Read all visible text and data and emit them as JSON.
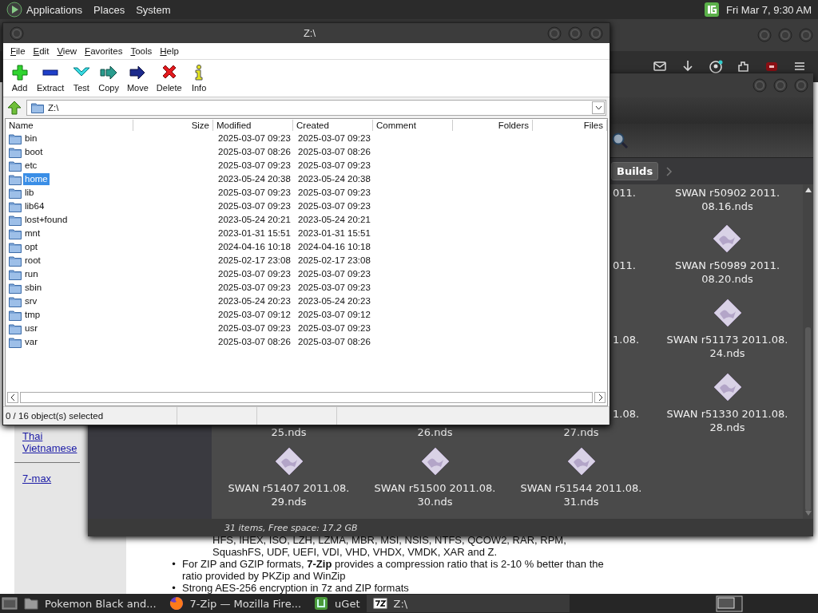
{
  "top_panel": {
    "menus": [
      "Applications",
      "Places",
      "System"
    ],
    "clock": "Fri Mar  7, 9:30 AM"
  },
  "browser": {
    "sidebar_links": [
      "Thai",
      "Vietnamese",
      "7-max"
    ],
    "format_lines": [
      "HFS, IHEX, ISO, LZH, LZMA, MBR, MSI, NSIS, NTFS, QCOW2, RAR, RPM,",
      "SquashFS, UDF, UEFI, VDI, VHD, VHDX, VMDK, XAR and Z."
    ],
    "bullets": [
      {
        "marker": "•",
        "text": "For ZIP and GZIP formats, **7-Zip** provides a compression ratio that is 2-10 % better than the ratio provided by PKZip and WinZip"
      },
      {
        "marker": "•",
        "text": "Strong AES-256 encryption in 7z and ZIP formats"
      }
    ]
  },
  "file_manager": {
    "breadcrumb": [
      {
        "label": "Builds",
        "selected": true
      }
    ],
    "grid": [
      [
        {
          "kind": "covered"
        },
        {
          "kind": "covered"
        },
        {
          "kind": "fragment",
          "edge": "011."
        },
        {
          "kind": "label-only",
          "lines": [
            "SWAN r50902 2011.",
            "08.16.nds"
          ]
        }
      ],
      [
        {
          "kind": "covered"
        },
        {
          "kind": "covered"
        },
        {
          "kind": "fragment",
          "edge": "011."
        },
        {
          "kind": "file",
          "lines": [
            "SWAN r50989 2011.",
            "08.20.nds"
          ]
        }
      ],
      [
        {
          "kind": "covered"
        },
        {
          "kind": "covered"
        },
        {
          "kind": "fragment",
          "edge": "1.08."
        },
        {
          "kind": "file",
          "lines": [
            "SWAN r51173 2011.08.",
            "24.nds"
          ]
        }
      ],
      [
        {
          "kind": "fragment",
          "tail": "25.nds"
        },
        {
          "kind": "fragment",
          "tail": "26.nds"
        },
        {
          "kind": "fragment",
          "edge": "1.08.",
          "tail": "27.nds"
        },
        {
          "kind": "file",
          "lines": [
            "SWAN r51330 2011.08.",
            "28.nds"
          ]
        }
      ],
      [
        {
          "kind": "file",
          "lines": [
            "SWAN r51407 2011.08.",
            "29.nds"
          ]
        },
        {
          "kind": "file",
          "lines": [
            "SWAN r51500 2011.08.",
            "30.nds"
          ]
        },
        {
          "kind": "file",
          "lines": [
            "SWAN r51544 2011.08.",
            "31.nds"
          ]
        }
      ]
    ],
    "status": "31 items, Free space: 17.2 GB"
  },
  "seven_zip": {
    "title": "Z:\\",
    "menu": [
      "File",
      "Edit",
      "View",
      "Favorites",
      "Tools",
      "Help"
    ],
    "toolbar": [
      {
        "kind": "add",
        "label": "Add"
      },
      {
        "kind": "extract",
        "label": "Extract"
      },
      {
        "kind": "test",
        "label": "Test"
      },
      {
        "kind": "copy",
        "label": "Copy"
      },
      {
        "kind": "move",
        "label": "Move"
      },
      {
        "kind": "delete",
        "label": "Delete"
      },
      {
        "kind": "info",
        "label": "Info"
      }
    ],
    "address": "Z:\\",
    "columns": [
      "Name",
      "Size",
      "Modified",
      "Created",
      "Comment",
      "Folders",
      "Files"
    ],
    "rows": [
      {
        "name": "bin",
        "modified": "2025-03-07 09:23",
        "created": "2025-03-07 09:23",
        "selected": false
      },
      {
        "name": "boot",
        "modified": "2025-03-07 08:26",
        "created": "2025-03-07 08:26",
        "selected": false
      },
      {
        "name": "etc",
        "modified": "2025-03-07 09:23",
        "created": "2025-03-07 09:23",
        "selected": false
      },
      {
        "name": "home",
        "modified": "2023-05-24 20:38",
        "created": "2023-05-24 20:38",
        "selected": true
      },
      {
        "name": "lib",
        "modified": "2025-03-07 09:23",
        "created": "2025-03-07 09:23",
        "selected": false
      },
      {
        "name": "lib64",
        "modified": "2025-03-07 09:23",
        "created": "2025-03-07 09:23",
        "selected": false
      },
      {
        "name": "lost+found",
        "modified": "2023-05-24 20:21",
        "created": "2023-05-24 20:21",
        "selected": false
      },
      {
        "name": "mnt",
        "modified": "2023-01-31 15:51",
        "created": "2023-01-31 15:51",
        "selected": false
      },
      {
        "name": "opt",
        "modified": "2024-04-16 10:18",
        "created": "2024-04-16 10:18",
        "selected": false
      },
      {
        "name": "root",
        "modified": "2025-02-17 23:08",
        "created": "2025-02-17 23:08",
        "selected": false
      },
      {
        "name": "run",
        "modified": "2025-03-07 09:23",
        "created": "2025-03-07 09:23",
        "selected": false
      },
      {
        "name": "sbin",
        "modified": "2025-03-07 09:23",
        "created": "2025-03-07 09:23",
        "selected": false
      },
      {
        "name": "srv",
        "modified": "2023-05-24 20:23",
        "created": "2023-05-24 20:23",
        "selected": false
      },
      {
        "name": "tmp",
        "modified": "2025-03-07 09:12",
        "created": "2025-03-07 09:12",
        "selected": false
      },
      {
        "name": "usr",
        "modified": "2025-03-07 09:23",
        "created": "2025-03-07 09:23",
        "selected": false
      },
      {
        "name": "var",
        "modified": "2025-03-07 08:26",
        "created": "2025-03-07 08:26",
        "selected": false
      }
    ],
    "status": "0 / 16 object(s) selected"
  },
  "taskbar": {
    "items": [
      {
        "kind": "folder",
        "label": "Pokemon Black and...",
        "selected": false
      },
      {
        "kind": "firefox",
        "label": "7-Zip — Mozilla Fire...",
        "selected": false
      },
      {
        "kind": "uget",
        "label": "uGet",
        "selected": false
      },
      {
        "kind": "sevenzip",
        "label": "Z:\\",
        "selected": true
      }
    ]
  }
}
